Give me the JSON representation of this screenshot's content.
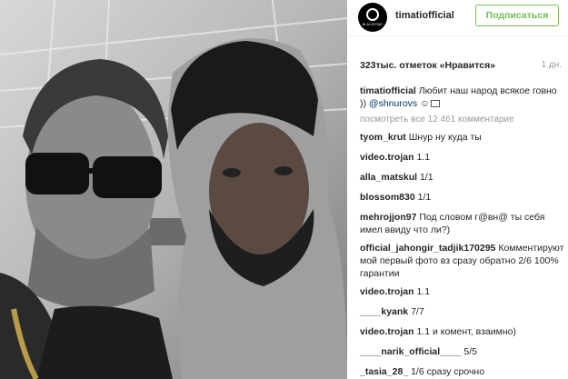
{
  "post": {
    "username": "timatiofficial",
    "follow_label": "Подписаться",
    "avatar_text": "BLACKSTAR",
    "likes_text": "323тыс. отметок «Нравится»",
    "age": "1 дн.",
    "caption_user": "timatiofficial",
    "caption_text": "Любит наш народ всякое говно ))",
    "caption_mention": "@shnurovs",
    "caption_emoji": "☺",
    "load_more": "посмотреть все 12 461 комментарие"
  },
  "comments": [
    {
      "user": "tyom_krut",
      "text": "Шнур ну куда ты"
    },
    {
      "user": "video.trojan",
      "text": "1.1"
    },
    {
      "user": "alla_matskul",
      "text": "1/1"
    },
    {
      "user": "blossom830",
      "text": "1/1"
    },
    {
      "user": "mehrojjon97",
      "text": "Под словом г@вн@ ты себя имел ввиду что ли?)"
    },
    {
      "user": "official_jahongir_tadjik170295",
      "text": "Комментируют мой первый фото вз сразу обратно 2/6 100% гарантии"
    },
    {
      "user": "video.trojan",
      "text": "1.1"
    },
    {
      "user": "____kyank",
      "text": "7/7"
    },
    {
      "user": "video.trojan",
      "text": "1.1 и комент, взаимно)"
    },
    {
      "user": "____narik_official____",
      "text": "5/5"
    },
    {
      "user": "_tasia_28_",
      "text": "1/6 сразу срочно"
    }
  ],
  "colors": {
    "follow": "#70c050",
    "mention": "#003569",
    "muted": "#999999"
  }
}
